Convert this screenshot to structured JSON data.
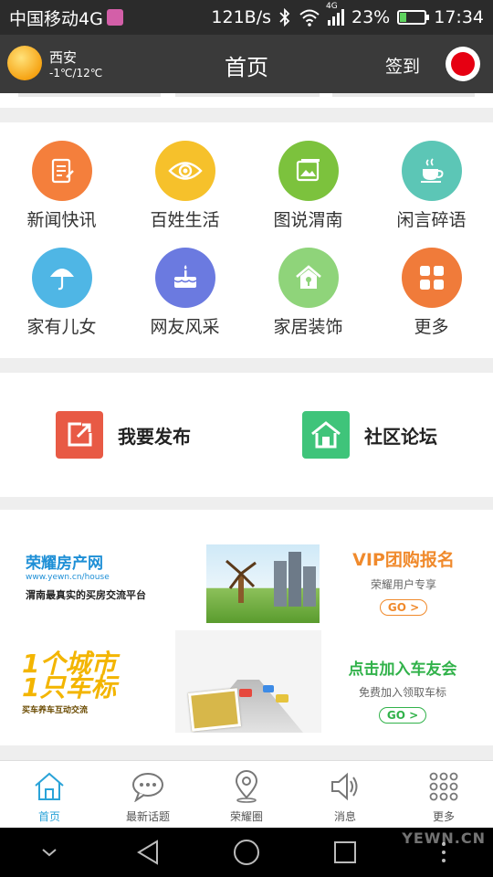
{
  "status_bar": {
    "carrier": "中国移动4G",
    "speed": "121B/s",
    "signal_tag": "4G",
    "battery": "23%",
    "battery_level": 0.23,
    "time": "17:34"
  },
  "header": {
    "city": "西安",
    "temperature": "-1℃/12℃",
    "title": "首页",
    "signin_label": "签到"
  },
  "categories": [
    {
      "label": "新闻快讯",
      "color": "#f47f3c",
      "icon": "news-icon"
    },
    {
      "label": "百姓生活",
      "color": "#f6c12b",
      "icon": "eye-icon"
    },
    {
      "label": "图说渭南",
      "color": "#7cc23d",
      "icon": "photo-icon"
    },
    {
      "label": "闲言碎语",
      "color": "#5cc6b6",
      "icon": "teacup-icon"
    },
    {
      "label": "家有儿女",
      "color": "#4fb6e5",
      "icon": "umbrella-icon"
    },
    {
      "label": "网友风采",
      "color": "#6b7ae0",
      "icon": "cake-icon"
    },
    {
      "label": "家居装饰",
      "color": "#8fd47a",
      "icon": "house-icon"
    },
    {
      "label": "更多",
      "color": "#f07b3a",
      "icon": "grid-icon"
    }
  ],
  "actions": {
    "publish_label": "我要发布",
    "publish_color": "#e85a45",
    "forum_label": "社区论坛",
    "forum_color": "#3fc47a"
  },
  "banner": {
    "house": {
      "brand_name": "荣耀房产网",
      "brand_url": "www.yewn.cn/house",
      "slogan": "渭南最真实的买房交流平台",
      "title": "VIP团购报名",
      "subtitle": "荣耀用户专享",
      "go": "GO >"
    },
    "car": {
      "brand_big_1": "1个城市",
      "brand_big_2": "1只车标",
      "brand_small": "买车养车互动交流",
      "title": "点击加入车友会",
      "subtitle": "免费加入领取车标",
      "go": "GO >"
    }
  },
  "tabs": [
    {
      "label": "首页",
      "icon": "home-icon",
      "active": true
    },
    {
      "label": "最新话题",
      "icon": "chat-bubble-icon",
      "active": false
    },
    {
      "label": "荣耀圈",
      "icon": "location-pin-icon",
      "active": false
    },
    {
      "label": "消息",
      "icon": "speaker-icon",
      "active": false
    },
    {
      "label": "更多",
      "icon": "dots-grid-icon",
      "active": false
    }
  ],
  "watermark": "YEWN.CN",
  "colors": {
    "accent": "#2aa3d8",
    "header_bg": "#3a3a3a",
    "status_bg": "#2b2b2b"
  }
}
